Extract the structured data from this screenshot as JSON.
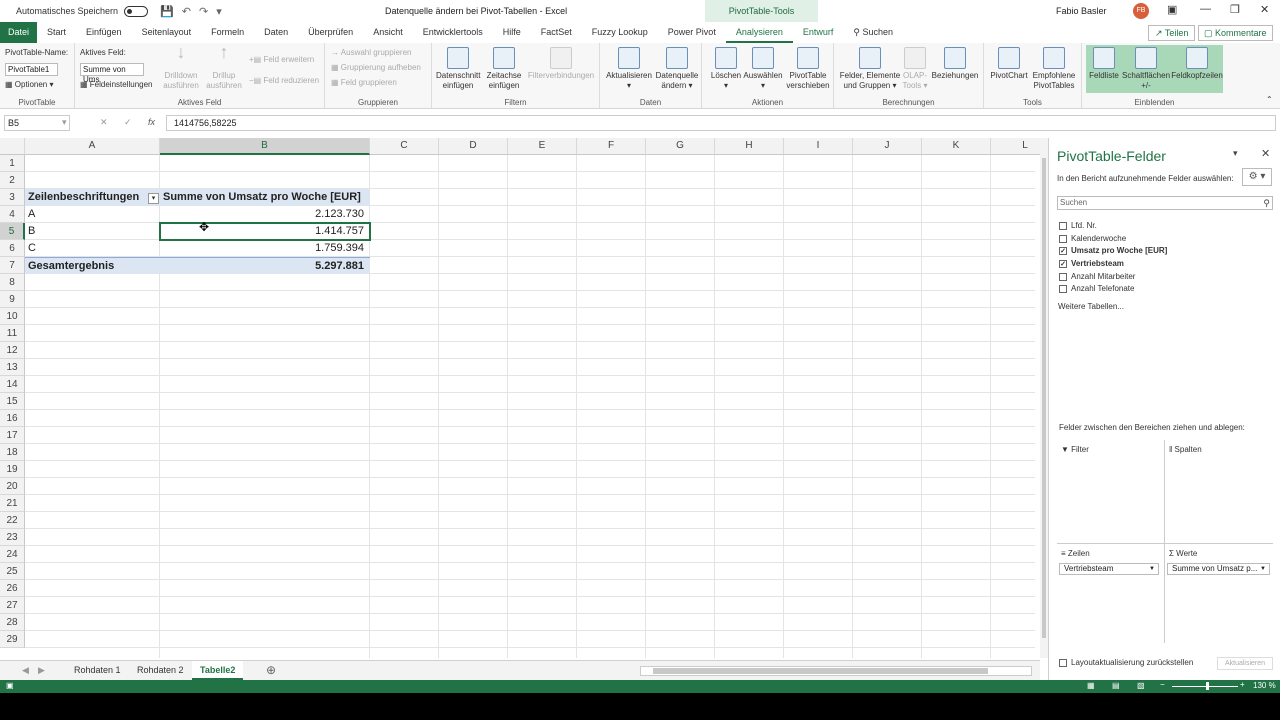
{
  "titlebar": {
    "autosave_label": "Automatisches Speichern",
    "doc_title": "Datenquelle ändern bei Pivot-Tabellen  -  Excel",
    "context_tools": "PivotTable-Tools",
    "user_name": "Fabio Basler",
    "user_initials": "FB"
  },
  "tabs": [
    "Datei",
    "Start",
    "Einfügen",
    "Seitenlayout",
    "Formeln",
    "Daten",
    "Überprüfen",
    "Ansicht",
    "Entwicklertools",
    "Hilfe",
    "FactSet",
    "Fuzzy Lookup",
    "Power Pivot",
    "Analysieren",
    "Entwurf"
  ],
  "tell_me": "Suchen",
  "share_label": "Teilen",
  "comments_label": "Kommentare",
  "ribbon": {
    "pivottable": {
      "name_label": "PivotTable-Name:",
      "name_value": "PivotTable1",
      "options": "Optionen",
      "group": "PivotTable"
    },
    "active_field": {
      "label": "Aktives Feld:",
      "value": "Summe von Ums",
      "settings": "Feldeinstellungen",
      "drilldown": "Drilldown ausführen",
      "drillup": "Drillup ausführen",
      "expand": "Feld erweitern",
      "collapse": "Feld reduzieren",
      "group": "Aktives Feld"
    },
    "grouping": {
      "sel": "Auswahl gruppieren",
      "ungroup": "Gruppierung aufheben",
      "field": "Feld gruppieren",
      "group": "Gruppieren"
    },
    "filter": {
      "slicer": "Datenschnitt einfügen",
      "timeline": "Zeitachse einfügen",
      "connections": "Filterverbindungen",
      "group": "Filtern"
    },
    "data": {
      "refresh": "Aktualisieren",
      "source": "Datenquelle ändern",
      "group": "Daten"
    },
    "actions": {
      "clear": "Löschen",
      "select": "Auswählen",
      "move": "PivotTable verschieben",
      "group": "Aktionen"
    },
    "calc": {
      "fields": "Felder, Elemente und Gruppen",
      "olap": "OLAP-Tools",
      "relations": "Beziehungen",
      "group": "Berechnungen"
    },
    "tools": {
      "chart": "PivotChart",
      "recommended": "Empfohlene PivotTables",
      "group": "Tools"
    },
    "show": {
      "fieldlist": "Feldliste",
      "buttons": "Schaltflächen +/-",
      "headers": "Feldkopfzeilen",
      "group": "Einblenden"
    }
  },
  "formula_bar": {
    "name_box": "B5",
    "value": "1414756,58225"
  },
  "columns": [
    "A",
    "B",
    "C",
    "D",
    "E",
    "F",
    "G",
    "H",
    "I",
    "J",
    "K",
    "L"
  ],
  "rows": [
    "1",
    "2",
    "3",
    "4",
    "5",
    "6",
    "7",
    "8",
    "9",
    "10",
    "11",
    "12",
    "13",
    "14",
    "15",
    "16",
    "17",
    "18",
    "19",
    "20",
    "21",
    "22",
    "23",
    "24",
    "25",
    "26",
    "27",
    "28",
    "29"
  ],
  "pivot": {
    "row_header": "Zeilenbeschriftungen",
    "value_header": "Summe von Umsatz pro Woche [EUR]",
    "items": [
      {
        "label": "A",
        "value": "2.123.730"
      },
      {
        "label": "B",
        "value": "1.414.757"
      },
      {
        "label": "C",
        "value": "1.759.394"
      }
    ],
    "total_label": "Gesamtergebnis",
    "total_value": "5.297.881"
  },
  "sheets": [
    "Rohdaten 1",
    "Rohdaten 2",
    "Tabelle2"
  ],
  "active_sheet": "Tabelle2",
  "status": {
    "zoom": "130 %"
  },
  "pane": {
    "title": "PivotTable-Felder",
    "subtitle": "In den Bericht aufzunehmende Felder auswählen:",
    "search_placeholder": "Suchen",
    "fields": [
      {
        "name": "Lfd. Nr.",
        "checked": false
      },
      {
        "name": "Kalenderwoche",
        "checked": false
      },
      {
        "name": "Umsatz pro Woche [EUR]",
        "checked": true
      },
      {
        "name": "Vertriebsteam",
        "checked": true
      },
      {
        "name": "Anzahl Mitarbeiter",
        "checked": false
      },
      {
        "name": "Anzahl Telefonate",
        "checked": false
      }
    ],
    "more_tables": "Weitere Tabellen...",
    "drag_hint": "Felder zwischen den Bereichen ziehen und ablegen:",
    "areas": {
      "filter": "Filter",
      "columns": "Spalten",
      "rows": "Zeilen",
      "values": "Werte"
    },
    "rows_value": "Vertriebsteam",
    "values_value": "Summe von Umsatz p...",
    "defer_label": "Layoutaktualisierung zurückstellen",
    "update_label": "Aktualisieren"
  },
  "colors": {
    "accent": "#217346",
    "pivot_header": "#dce6f2",
    "selected_show": "#a9d8b8"
  }
}
